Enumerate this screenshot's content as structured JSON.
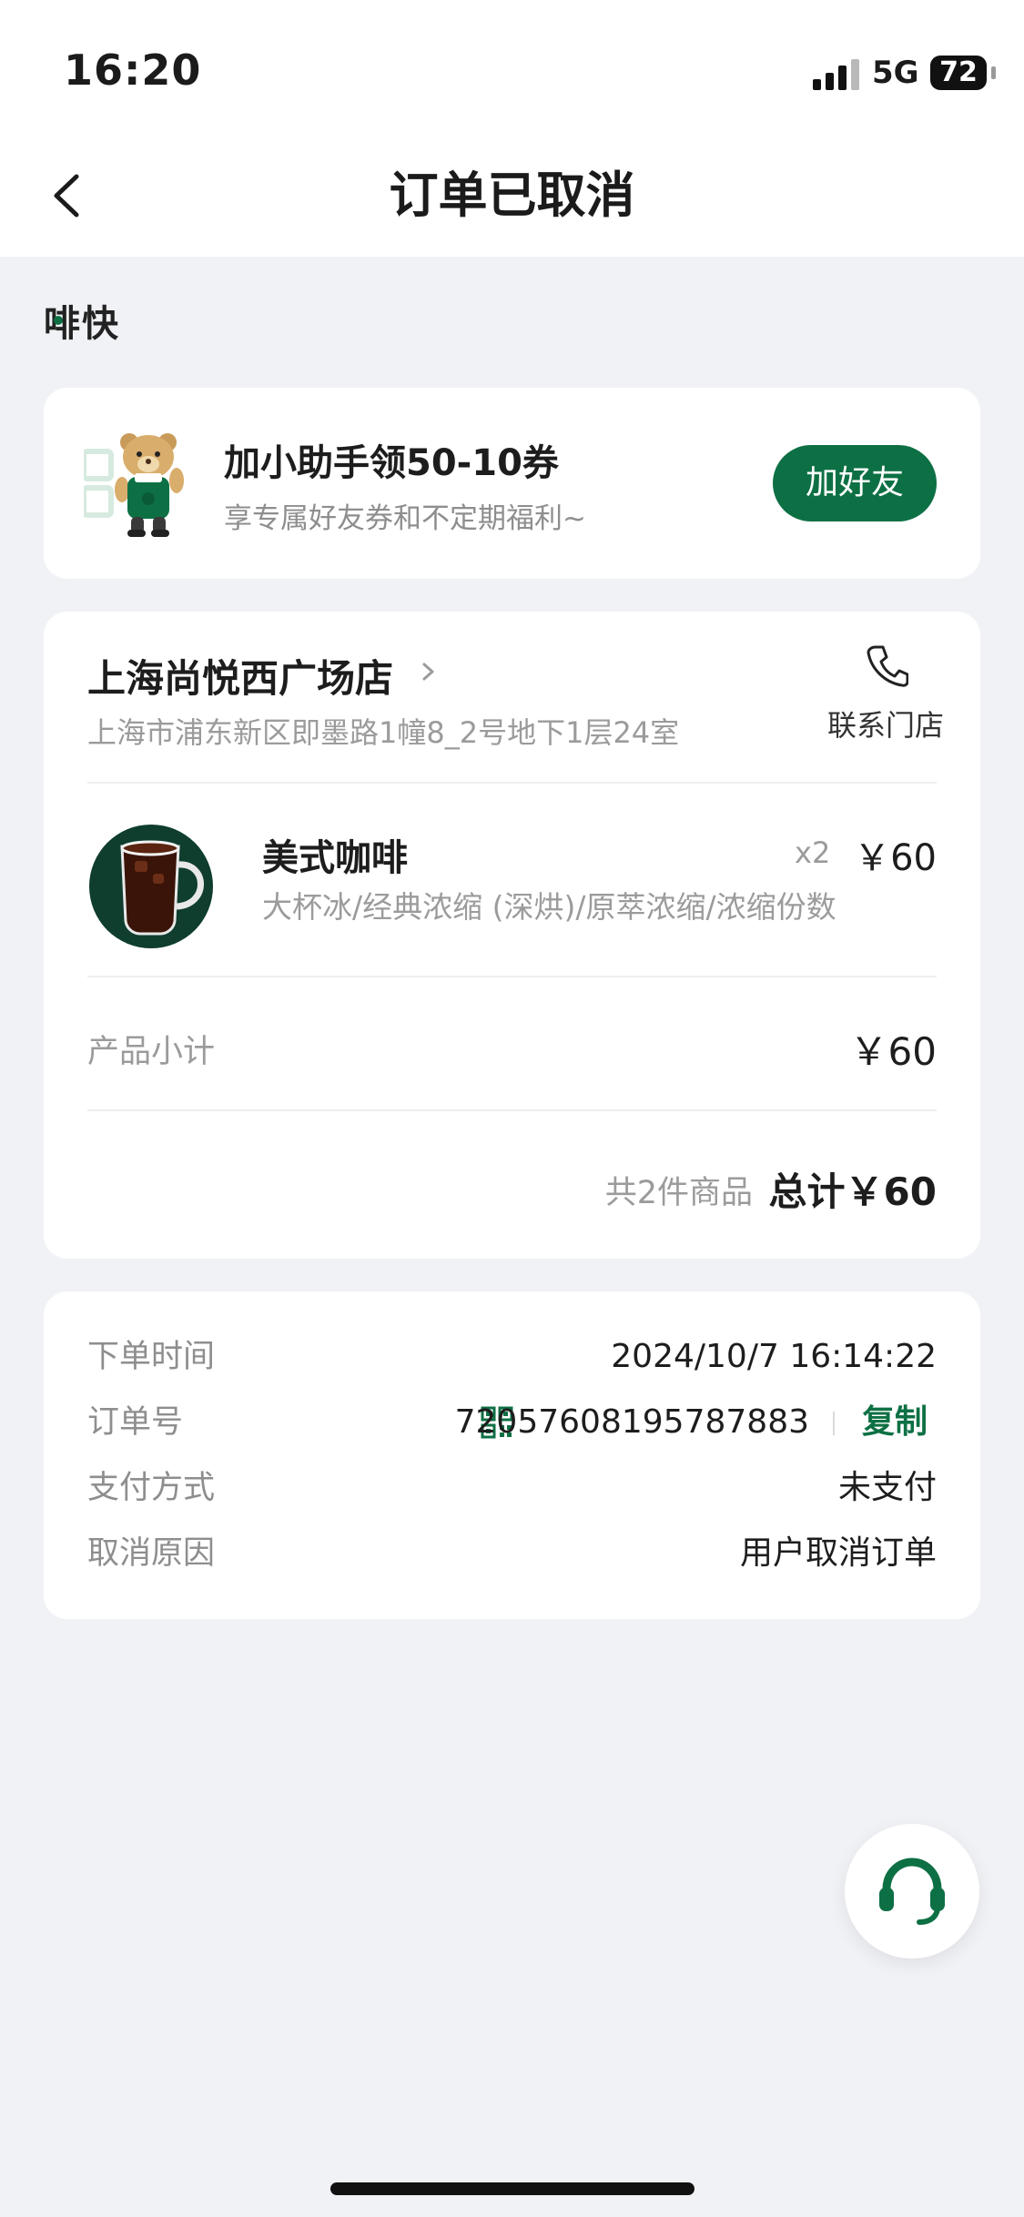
{
  "status_bar": {
    "time": "16:20",
    "network": "5G",
    "battery": "72"
  },
  "nav": {
    "title": "订单已取消"
  },
  "brand": {
    "name": "啡快"
  },
  "promo": {
    "title": "加小助手领50-10券",
    "subtitle": "享专属好友券和不定期福利~",
    "button": "加好友"
  },
  "store": {
    "name": "上海尚悦西广场店",
    "address": "上海市浦东新区即墨路1幢8_2号地下1层24室",
    "contact_label": "联系门店"
  },
  "items": [
    {
      "name": "美式咖啡",
      "options": "大杯冰/经典浓缩 (深烘)/原萃浓缩/浓缩份数",
      "quantity": "x2",
      "price": "￥60"
    }
  ],
  "summary": {
    "subtotal_label": "产品小计",
    "subtotal_value": "￥60",
    "count_label": "共2件商品",
    "total": "总计￥60"
  },
  "info": {
    "order_time_label": "下单时间",
    "order_time": "2024/10/7 16:14:22",
    "order_no_label": "订单号",
    "order_no": "72057608195787883",
    "copy_label": "复制",
    "payment_label": "支付方式",
    "payment": "未支付",
    "cancel_reason_label": "取消原因",
    "cancel_reason": "用户取消订单"
  },
  "icons": {
    "back": "chevron-left-icon",
    "store_arrow": "chevron-right-icon",
    "phone": "phone-icon",
    "qr": "qr-code-icon",
    "support": "headset-icon"
  },
  "colors": {
    "accent": "#0d7044",
    "background": "#f1f2f6"
  }
}
